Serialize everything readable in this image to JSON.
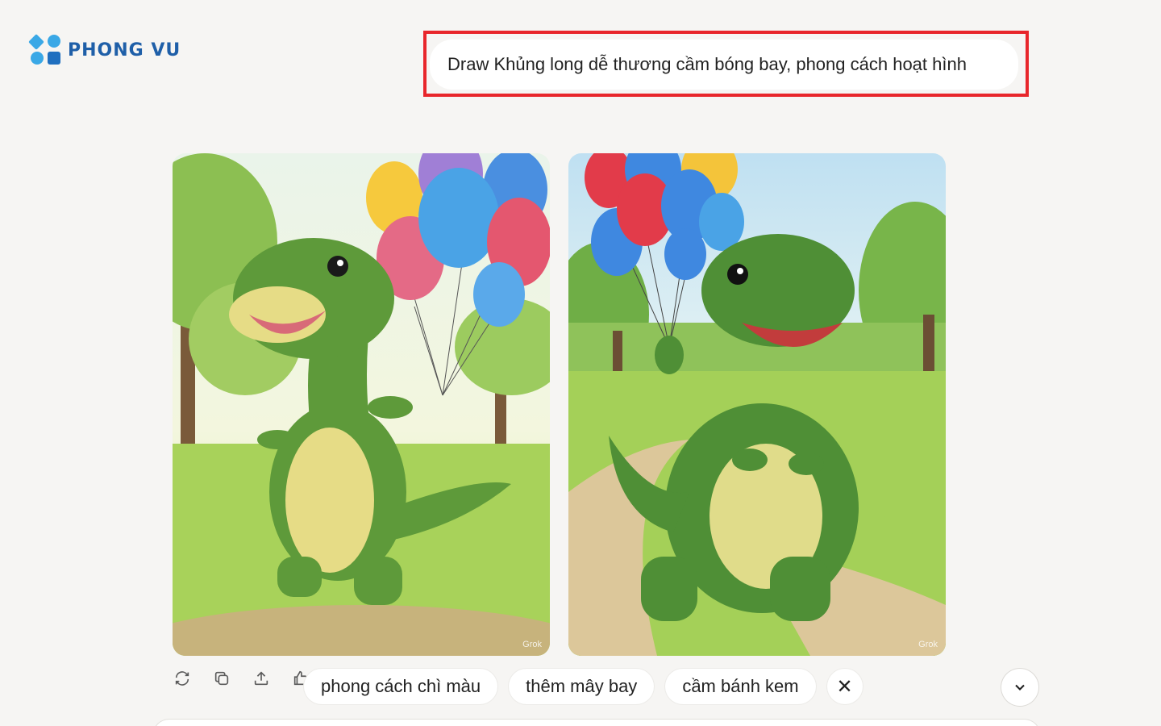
{
  "logo": {
    "text": "PHONG VU"
  },
  "prompt": {
    "text": "Draw Khủng long dễ thương cầm bóng bay, phong cách hoạt hình"
  },
  "images": [
    {
      "watermark": "Grok"
    },
    {
      "watermark": "Grok"
    }
  ],
  "actions": [
    "refresh-icon",
    "copy-icon",
    "share-icon",
    "thumbs-up-icon"
  ],
  "suggestions": [
    "phong cách chì màu",
    "thêm mây bay",
    "cầm bánh kem"
  ],
  "colors": {
    "highlight": "#e8262b",
    "background": "#f6f5f3",
    "dino": "#5e9a3a",
    "belly": "#e6dc86"
  }
}
